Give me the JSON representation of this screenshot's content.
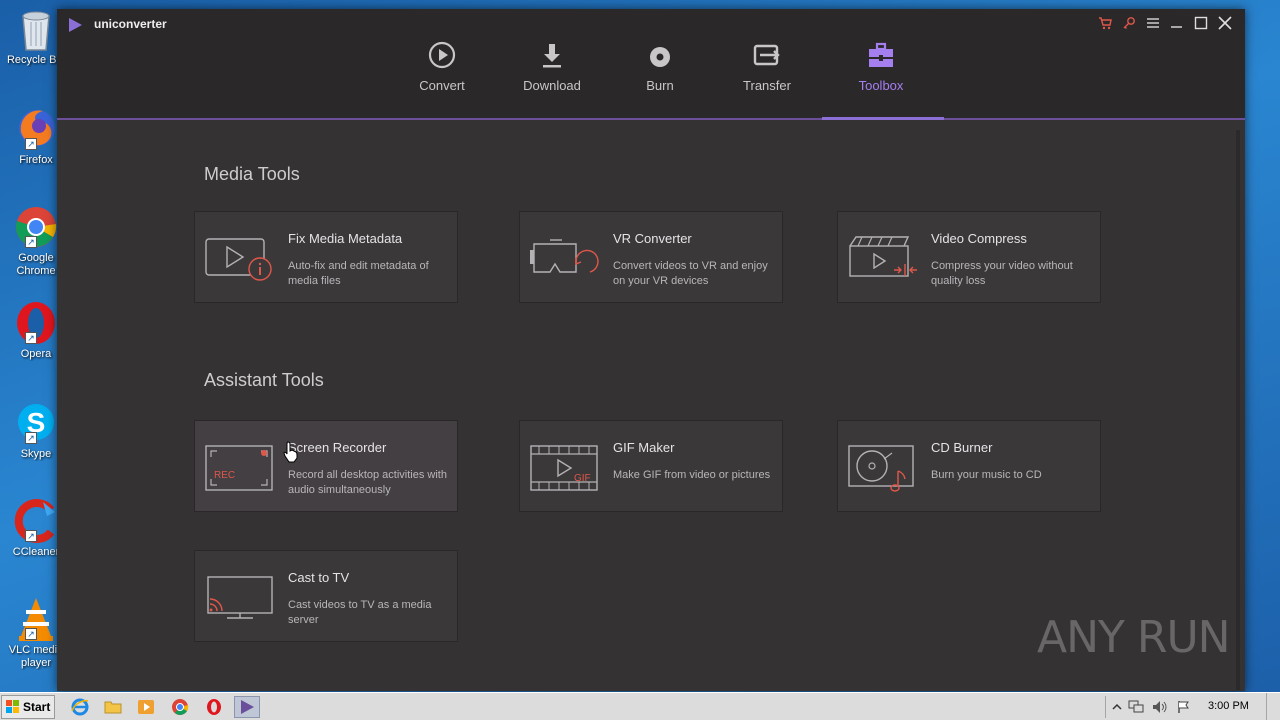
{
  "desktop": {
    "icons": [
      {
        "label": "Recycle Bin",
        "icon": "recycle-bin-icon"
      },
      {
        "label": "Firefox",
        "icon": "firefox-icon"
      },
      {
        "label": "Google Chrome",
        "icon": "chrome-icon"
      },
      {
        "label": "Opera",
        "icon": "opera-icon"
      },
      {
        "label": "Skype",
        "icon": "skype-icon"
      },
      {
        "label": "CCleaner",
        "icon": "ccleaner-icon"
      },
      {
        "label": "VLC media player",
        "icon": "vlc-icon"
      }
    ]
  },
  "app": {
    "title": "uniconverter",
    "accent_color": "#a57ef0",
    "header_icons": [
      "cart-icon",
      "key-icon",
      "menu-icon",
      "minimize-icon",
      "maximize-icon",
      "close-icon"
    ],
    "tabs": [
      {
        "label": "Convert",
        "icon": "convert-icon"
      },
      {
        "label": "Download",
        "icon": "download-icon"
      },
      {
        "label": "Burn",
        "icon": "burn-icon"
      },
      {
        "label": "Transfer",
        "icon": "transfer-icon"
      },
      {
        "label": "Toolbox",
        "icon": "toolbox-icon",
        "active": true
      }
    ],
    "sections": {
      "media_tools": {
        "title": "Media Tools",
        "cards": [
          {
            "title": "Fix Media Metadata",
            "desc": "Auto-fix and edit metadata of media files",
            "icon": "fix-metadata-icon"
          },
          {
            "title": "VR Converter",
            "desc": "Convert videos to VR and enjoy on your VR devices",
            "icon": "vr-converter-icon"
          },
          {
            "title": "Video Compress",
            "desc": "Compress your video without quality loss",
            "icon": "video-compress-icon"
          }
        ]
      },
      "assistant_tools": {
        "title": "Assistant Tools",
        "cards": [
          {
            "title": "Screen Recorder",
            "desc": "Record all desktop activities with audio simultaneously",
            "icon": "screen-recorder-icon",
            "icon_text": "REC"
          },
          {
            "title": "GIF Maker",
            "desc": "Make GIF from video or pictures",
            "icon": "gif-maker-icon",
            "icon_text": "GIF"
          },
          {
            "title": "CD Burner",
            "desc": "Burn your music to CD",
            "icon": "cd-burner-icon"
          },
          {
            "title": "Cast to TV",
            "desc": "Cast videos to TV as a media server",
            "icon": "cast-to-tv-icon"
          }
        ]
      }
    },
    "watermark": "ANY RUN"
  },
  "taskbar": {
    "start_label": "Start",
    "pinned": [
      "ie-icon",
      "explorer-icon",
      "media-player-icon",
      "chrome-icon",
      "opera-icon",
      "uniconverter-icon"
    ],
    "tray_icons": [
      "show-hidden-icon",
      "network-icon",
      "volume-icon",
      "flag-icon"
    ],
    "clock": "3:00 PM"
  }
}
